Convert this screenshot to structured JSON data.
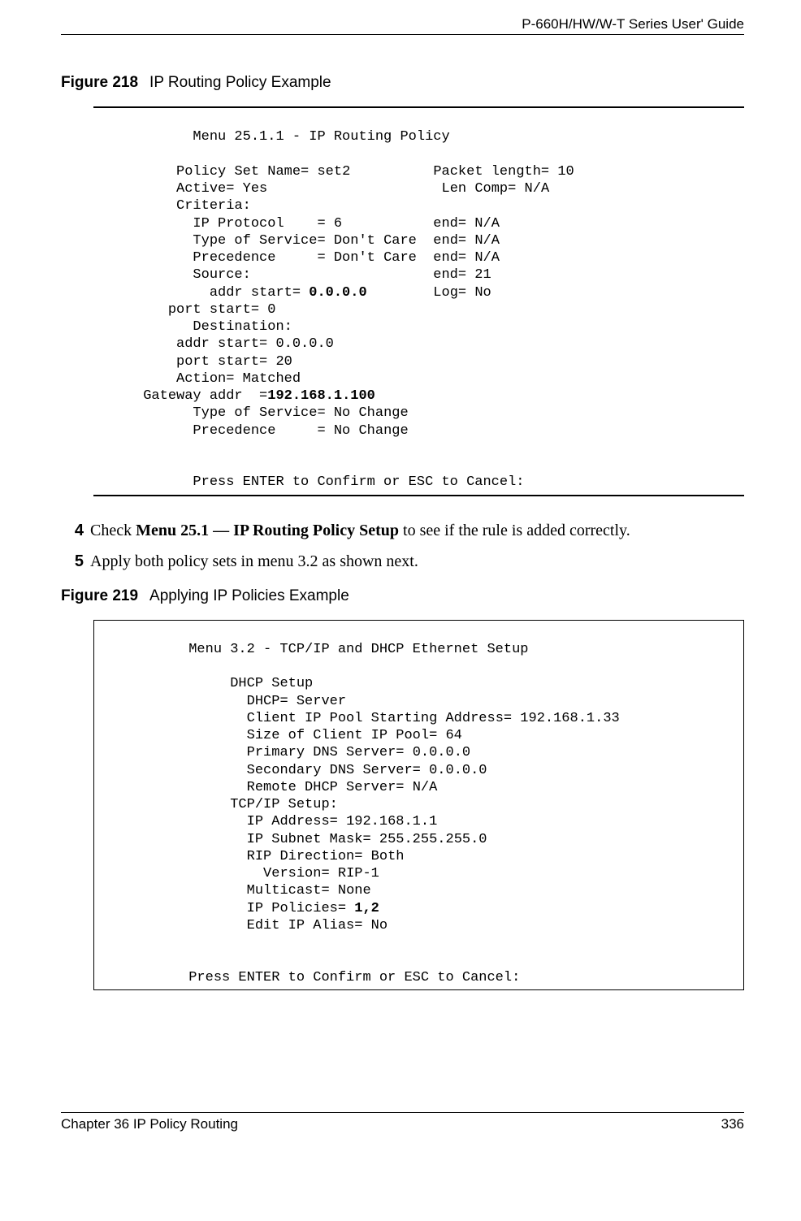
{
  "header": {
    "guide_title": "P-660H/HW/W-T Series User' Guide"
  },
  "figure218": {
    "label": "Figure 218",
    "title": "IP Routing Policy Example",
    "menu_title": "Menu 25.1.1 - IP Routing Policy",
    "policy_set_name_label": "Policy Set Name=",
    "policy_set_name_value": "set2",
    "packet_length_label": "Packet length=",
    "packet_length_value": "10",
    "active_label": "Active=",
    "active_value": "Yes",
    "len_comp_label": "Len Comp=",
    "len_comp_value": "N/A",
    "criteria_label": "Criteria:",
    "ip_protocol_label": "IP Protocol    =",
    "ip_protocol_value": "6",
    "ip_protocol_end_label": "end=",
    "ip_protocol_end_value": "N/A",
    "tos_label": "Type of Service=",
    "tos_value": "Don't Care",
    "tos_end_label": "end=",
    "tos_end_value": "N/A",
    "prec_label": "Precedence     =",
    "prec_value": "Don't Care",
    "prec_end_label": "end=",
    "prec_end_value": "N/A",
    "source_label": "Source:",
    "source_end_label": "end=",
    "source_end_value": "21",
    "src_addr_start_label": "addr start=",
    "src_addr_start_value": "0.0.0.0",
    "log_label": "Log=",
    "log_value": "No",
    "src_port_start_label": "port start=",
    "src_port_start_value": "0",
    "destination_label": "Destination:",
    "dst_addr_start_label": "addr start=",
    "dst_addr_start_value": "0.0.0.0",
    "dst_port_start_label": "port start=",
    "dst_port_start_value": "20",
    "action_label": "Action=",
    "action_value": "Matched",
    "gateway_addr_label": "Gateway addr  =",
    "gateway_addr_value": "192.168.1.100",
    "action_tos_label": "Type of Service=",
    "action_tos_value": "No Change",
    "action_prec_label": "Precedence     =",
    "action_prec_value": "No Change",
    "prompt": "Press ENTER to Confirm or ESC to Cancel:"
  },
  "steps": {
    "s4_num": "4",
    "s4_pre": "Check ",
    "s4_bold": "Menu 25.1 — IP Routing Policy Setup",
    "s4_post": " to see if the rule is added correctly.",
    "s5_num": "5",
    "s5_text": "Apply both policy sets in menu 3.2 as shown next."
  },
  "figure219": {
    "label": "Figure 219",
    "title": "Applying IP Policies Example",
    "menu_title": "Menu 3.2 - TCP/IP and DHCP Ethernet Setup",
    "dhcp_setup_label": "DHCP Setup",
    "dhcp_label": "DHCP=",
    "dhcp_value": "Server",
    "client_ip_label": "Client IP Pool Starting Address=",
    "client_ip_value": "192.168.1.33",
    "pool_size_label": "Size of Client IP Pool=",
    "pool_size_value": "64",
    "pri_dns_label": "Primary DNS Server=",
    "pri_dns_value": "0.0.0.0",
    "sec_dns_label": "Secondary DNS Server=",
    "sec_dns_value": "0.0.0.0",
    "remote_dhcp_label": "Remote DHCP Server=",
    "remote_dhcp_value": "N/A",
    "tcpip_setup_label": "TCP/IP Setup:",
    "ip_addr_label": "IP Address=",
    "ip_addr_value": "192.168.1.1",
    "subnet_label": "IP Subnet Mask=",
    "subnet_value": "255.255.255.0",
    "rip_dir_label": "RIP Direction=",
    "rip_dir_value": "Both",
    "version_label": "Version=",
    "version_value": "RIP-1",
    "multicast_label": "Multicast=",
    "multicast_value": "None",
    "ip_policies_label": "IP Policies=",
    "ip_policies_value": "1,2",
    "edit_alias_label": "Edit IP Alias=",
    "edit_alias_value": "No",
    "prompt": "Press ENTER to Confirm or ESC to Cancel:"
  },
  "footer": {
    "chapter": "Chapter 36 IP Policy Routing",
    "page": "336"
  }
}
